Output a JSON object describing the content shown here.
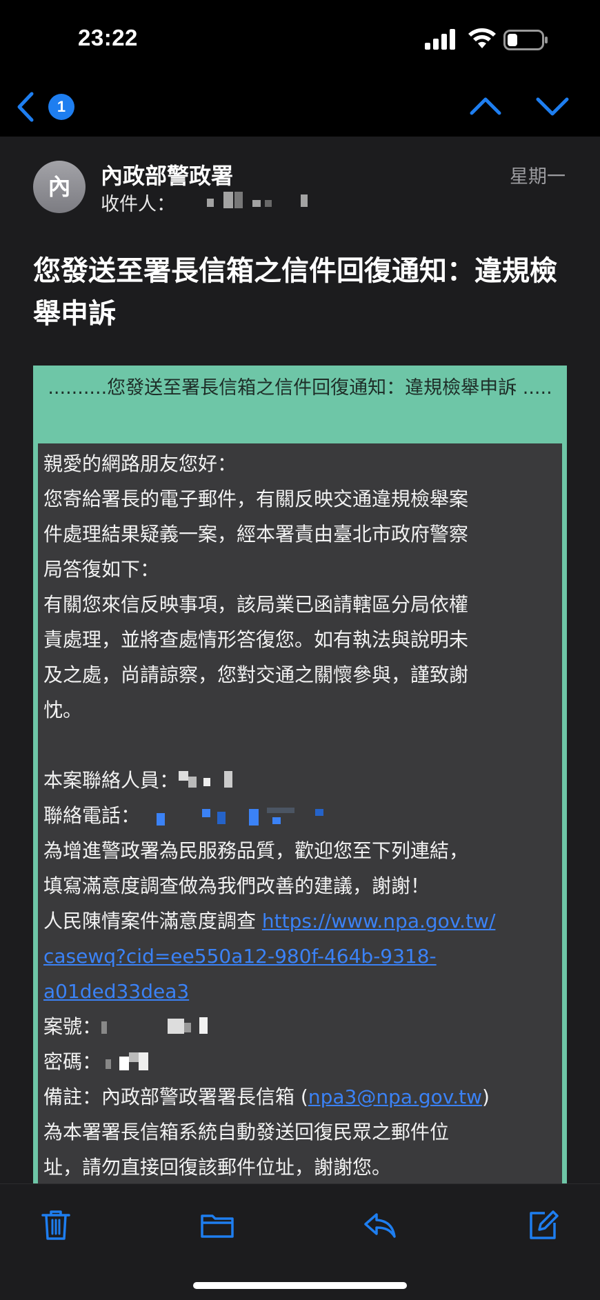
{
  "status_bar": {
    "time": "23:22",
    "icons": [
      "cellular-signal-icon",
      "wifi-icon",
      "battery-icon"
    ]
  },
  "nav_bar": {
    "unread_count": "1",
    "icons": [
      "back-chevron-icon",
      "up-arrow-icon",
      "down-arrow-icon"
    ]
  },
  "mail": {
    "avatar_initial": "內",
    "sender": "內政部警政署",
    "recipient_label": "收件人：",
    "date": "星期一",
    "subject": "您發送至署長信箱之信件回復通知：違規檢舉申訴"
  },
  "card": {
    "header": "..........您發送至署長信箱之信件回復通知：違規檢舉申訴 .....",
    "greeting": "親愛的網路朋友您好：",
    "para1_l1": "您寄給署長的電子郵件，有關反映交通違規檢舉案",
    "para1_l2": "件處理結果疑義一案，經本署責由臺北市政府警察",
    "para1_l3": "局答復如下：",
    "para2_l1": "有關您來信反映事項，該局業已函請轄區分局依權",
    "para2_l2": "責處理，並將查處情形答復您。如有執法與說明未",
    "para2_l3": "及之處，尚請諒察，您對交通之關懷參與，謹致謝",
    "para2_l4": "忱。",
    "contact_label": "本案聯絡人員：",
    "phone_label": "聯絡電話：",
    "survey_l1": "為增進警政署為民服務品質，歡迎您至下列連結，",
    "survey_l2": "填寫滿意度調查做為我們改善的建議，謝謝！",
    "survey_label": "人民陳情案件滿意度調查 ",
    "survey_url_1": "https://www.npa.gov.tw/",
    "survey_url_2": "casewq?cid=ee550a12-980f-464b-9318-",
    "survey_url_3": "a01ded33dea3",
    "case_label": "案號：",
    "password_label": "密碼：",
    "note_prefix": "備註：內政部警政署署長信箱 (",
    "note_email": "npa3@npa.gov.tw",
    "note_suffix": ")",
    "note_l2": "為本署署長信箱系統自動發送回復民眾之郵件位",
    "note_l3": "址，請勿直接回復該郵件位址，謝謝您。"
  },
  "toolbar": {
    "icons": [
      "trash-icon",
      "folder-icon",
      "reply-icon",
      "compose-icon"
    ]
  },
  "colors": {
    "accent": "#1e7ef0",
    "card_green": "#6ec6a7",
    "card_body": "#3a3a3c",
    "link": "#3b82f6"
  }
}
